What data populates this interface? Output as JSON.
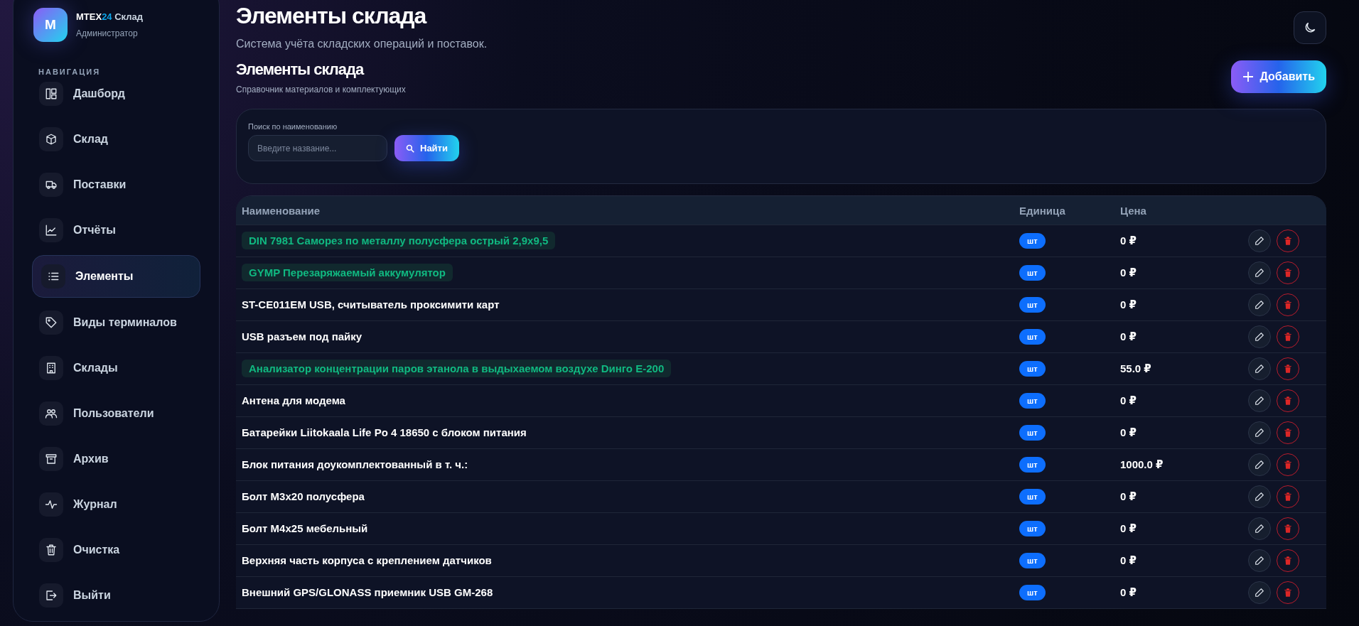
{
  "sidebar": {
    "logo_letter": "M",
    "brand": {
      "name": "MTEX",
      "accent": "24",
      "suffix": "Склад"
    },
    "role": "Администратор",
    "section_title": "НАВИГАЦИЯ",
    "items": [
      {
        "label": "Дашборд",
        "selected": false
      },
      {
        "label": "Склад",
        "selected": false
      },
      {
        "label": "Поставки",
        "selected": false
      },
      {
        "label": "Отчёты",
        "selected": false
      },
      {
        "label": "Элементы",
        "selected": true
      },
      {
        "label": "Виды терминалов",
        "selected": false
      },
      {
        "label": "Склады",
        "selected": false
      },
      {
        "label": "Пользователи",
        "selected": false
      },
      {
        "label": "Архив",
        "selected": false
      },
      {
        "label": "Журнал",
        "selected": false
      },
      {
        "label": "Очистка",
        "selected": false
      },
      {
        "label": "Выйти",
        "selected": false
      }
    ]
  },
  "header": {
    "title": "Элементы склада",
    "subtitle": "Система учёта складских операций и поставок."
  },
  "section": {
    "title": "Элементы склада",
    "subtitle": "Справочник материалов и комплектующих",
    "add_button": "Добавить"
  },
  "search": {
    "label": "Поиск по наименованию",
    "placeholder": "Введите название...",
    "button": "Найти"
  },
  "table": {
    "columns": [
      "Наименование",
      "Единица",
      "Цена"
    ],
    "rows": [
      {
        "name": "DIN 7981 Саморез по металлу полусфера острый 2,9x9,5",
        "highlighted": true,
        "unit": "шт",
        "price": "0 ₽"
      },
      {
        "name": "GYMP Перезаряжаемый аккумулятор",
        "highlighted": true,
        "unit": "шт",
        "price": "0 ₽"
      },
      {
        "name": "ST-CE011EM USB, считыватель проксимити карт",
        "highlighted": false,
        "unit": "шт",
        "price": "0 ₽"
      },
      {
        "name": "USB разъем под пайку",
        "highlighted": false,
        "unit": "шт",
        "price": "0 ₽"
      },
      {
        "name": "Анализатор концентрации паров этанола в выдыхаемом воздухе Dинго E-200",
        "highlighted": true,
        "unit": "шт",
        "price": "55.0 ₽"
      },
      {
        "name": "Антена для модема",
        "highlighted": false,
        "unit": "шт",
        "price": "0 ₽"
      },
      {
        "name": "Батарейки Liitokaala Life Po 4 18650 с блоком питания",
        "highlighted": false,
        "unit": "шт",
        "price": "0 ₽"
      },
      {
        "name": "Блок питания доукомплектованный в т. ч.:",
        "highlighted": false,
        "unit": "шт",
        "price": "1000.0 ₽"
      },
      {
        "name": "Болт M3x20 полусфера",
        "highlighted": false,
        "unit": "шт",
        "price": "0 ₽"
      },
      {
        "name": "Болт M4x25 мебельный",
        "highlighted": false,
        "unit": "шт",
        "price": "0 ₽"
      },
      {
        "name": "Верхняя часть корпуса с креплением датчиков",
        "highlighted": false,
        "unit": "шт",
        "price": "0 ₽"
      },
      {
        "name": "Внешний GPS/GLONASS приемник USB GM-268",
        "highlighted": false,
        "unit": "шт",
        "price": "0 ₽"
      }
    ]
  }
}
